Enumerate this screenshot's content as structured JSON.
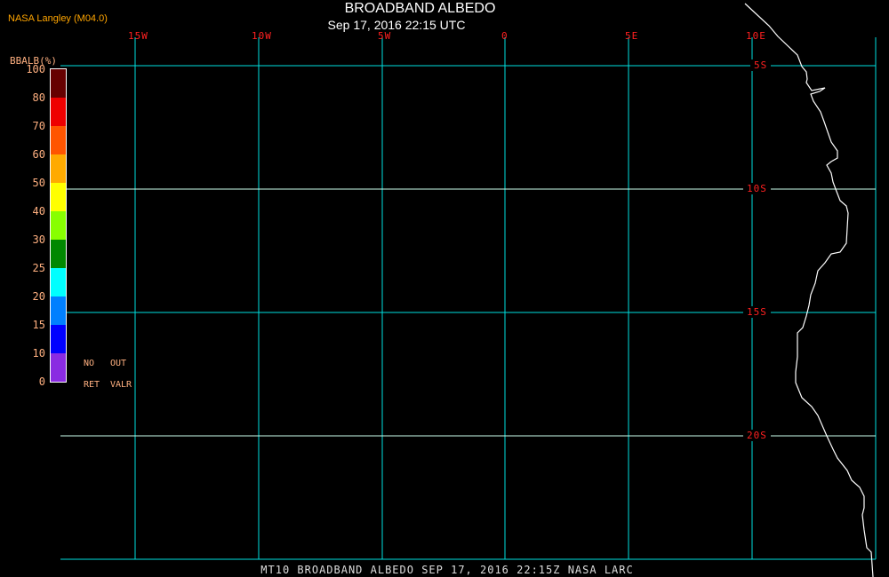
{
  "header": {
    "title": "BROADBAND ALBEDO",
    "subtitle": "Sep 17, 2016 22:15 UTC",
    "credit": "NASA Langley (M04.0)"
  },
  "footer": "MT10  BROADBAND ALBEDO  SEP 17, 2016 22:15Z  NASA LARC",
  "longitude_labels": [
    "15W",
    "10W",
    "5W",
    "0",
    "5E",
    "10E"
  ],
  "latitude_labels": [
    "5S",
    "10S",
    "15S",
    "20S"
  ],
  "colorbar": {
    "title": "BBALB(%)",
    "tick_labels": [
      "100",
      "80",
      "70",
      "60",
      "50",
      "40",
      "30",
      "25",
      "20",
      "15",
      "10",
      "0"
    ],
    "colors": [
      "#660000",
      "#ee0000",
      "#ff5500",
      "#ffaa00",
      "#ffff00",
      "#88ff00",
      "#008800",
      "#00ffff",
      "#0080ff",
      "#0000ff",
      "#8a2be2"
    ],
    "notes": [
      "NO",
      "OUT",
      "RET",
      "VALR"
    ]
  },
  "colors": {
    "grid": "#00e0e0",
    "labels": "#ff2020",
    "coastline": "#ffffff"
  }
}
